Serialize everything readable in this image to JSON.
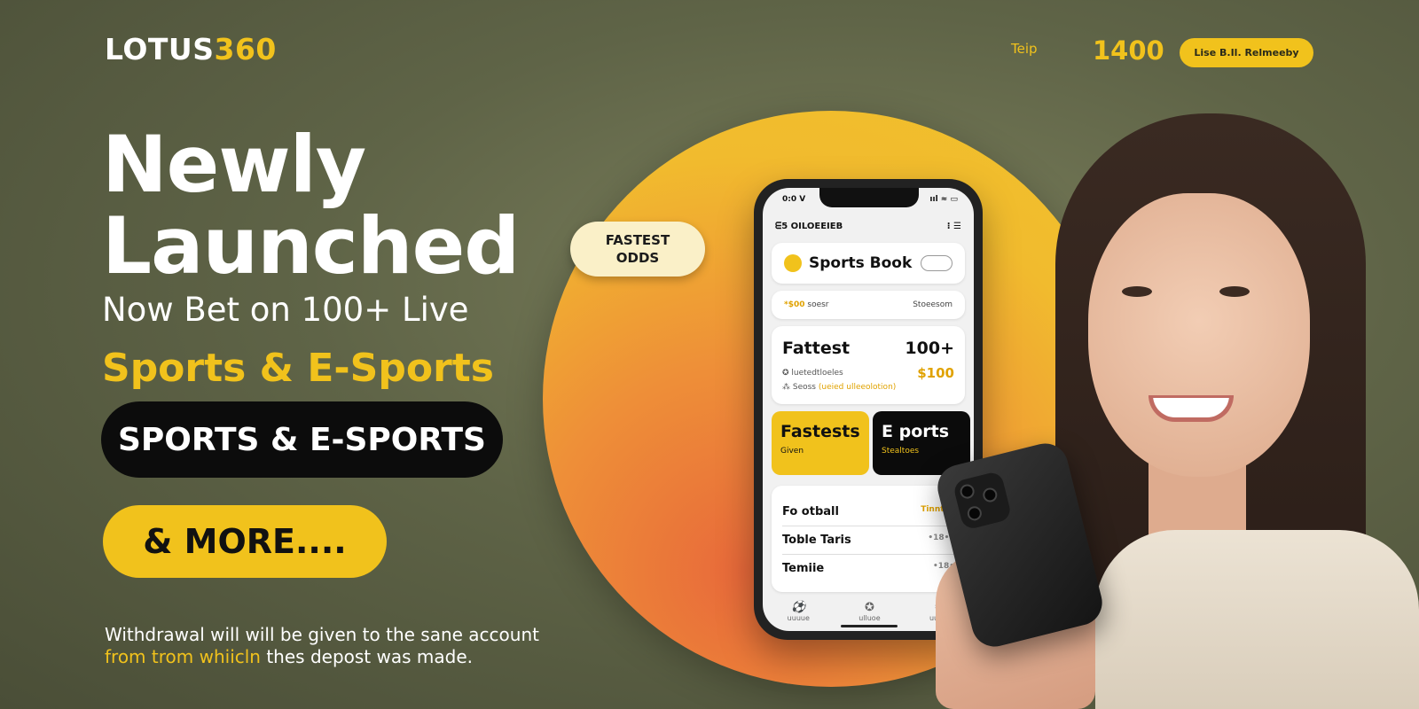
{
  "header": {
    "logo_main": "LOTUS",
    "logo_accent": "360",
    "help": "Teip",
    "number": "1400",
    "button": "Lise B.Il. Relmeeby"
  },
  "hero": {
    "line1": "Newly",
    "line2": "Launched",
    "sub1": "Now Bet on 100+ Live",
    "sub2": "Sports & E-Sports",
    "pill_black": "SPORTS & E-SPORTS",
    "pill_yellow": "& MORE....",
    "disclaimer_line1": "Withdrawal will will be given to the sane account",
    "disclaimer_line2_accent": "from trom whiicln",
    "disclaimer_line2_rest": " thes depost was made."
  },
  "badge": {
    "line1": "FASTEST",
    "line2": "ODDS"
  },
  "phone": {
    "status_left": "0:0 V",
    "status_right": "ııl ≈ ▭",
    "appbar_title": "ᗴ5 OILOEEIEB",
    "appbar_icons": "⁝ ☰",
    "sports_book": "Sports Book",
    "mini_left_accent": "*$00",
    "mini_left": "soesr",
    "mini_right": "Stoeesom",
    "info_title": "Fattest",
    "info_count": "100+",
    "info_line1": "✪ luetedtloeles",
    "info_amount": "$100",
    "info_line2": "⁂ Seoss",
    "info_line2_accent": "(ueied ulleeolotion)",
    "tile_yellow_title": "Fastests",
    "tile_yellow_sub": "Given",
    "tile_black_title": "E ports",
    "tile_black_sub": "Stealtoes",
    "list": [
      {
        "name": "Fo otball",
        "value": "Tinntes"
      },
      {
        "name": "Toble Taris",
        "value": "•18•∘"
      },
      {
        "name": "Temiie",
        "value": "•18•"
      }
    ],
    "tabs": [
      "uuuue",
      "ulluoe",
      "uuuie"
    ]
  }
}
